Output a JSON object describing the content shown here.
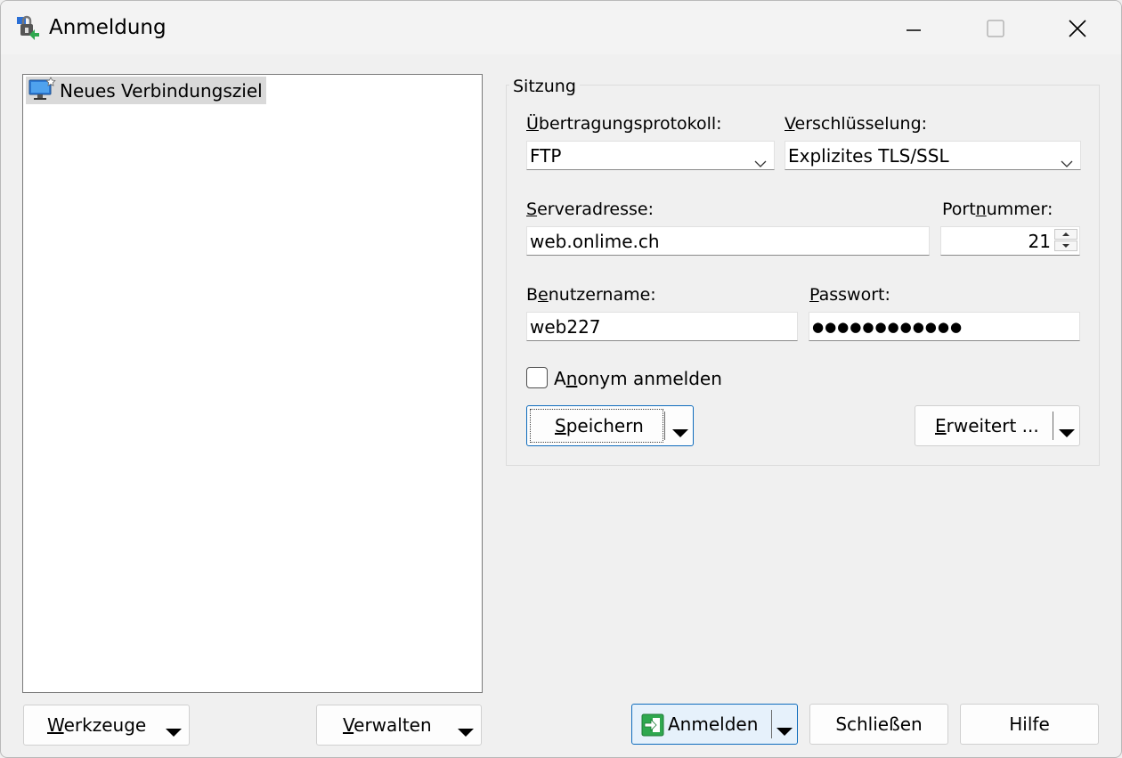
{
  "window": {
    "title": "Anmeldung",
    "controls": {
      "minimize": "minimize-icon",
      "maximize": "maximize-icon",
      "close": "close-icon"
    }
  },
  "sites_tree": {
    "items": [
      {
        "label": "Neues Verbindungsziel",
        "icon": "new-site-monitor-icon",
        "selected": true
      }
    ]
  },
  "session": {
    "group_title": "Sitzung",
    "protocol": {
      "label_access": "Ü",
      "label_rest": "bertragungsprotokoll:",
      "value": "FTP"
    },
    "encryption": {
      "label_access": "V",
      "label_rest": "erschlüsselung:",
      "value": "Explizites TLS/SSL"
    },
    "server": {
      "label_access": "S",
      "label_rest": "erveradresse:",
      "value": "web.onlime.ch"
    },
    "port": {
      "label_pre": "Port",
      "label_access": "n",
      "label_rest": "ummer:",
      "value": "21"
    },
    "username": {
      "label_pre": "B",
      "label_access": "e",
      "label_rest": "nutzername:",
      "value": "web227"
    },
    "password": {
      "label_access": "P",
      "label_rest": "asswort:",
      "value": "●●●●●●●●●●●●"
    },
    "anonymous": {
      "label_pre": "A",
      "label_access": "n",
      "label_rest": "onym anmelden",
      "checked": false
    },
    "save_button": {
      "access": "S",
      "rest": "peichern"
    },
    "advanced_button": {
      "access": "E",
      "rest": "rweitert ..."
    }
  },
  "footer": {
    "tools_button": {
      "access": "W",
      "rest": "erkzeuge"
    },
    "manage_button": {
      "access": "V",
      "rest": "erwalten"
    },
    "login_button": {
      "label": "Anmelden",
      "icon": "login-icon"
    },
    "close_button": "Schließen",
    "help_button": "Hilfe"
  },
  "colors": {
    "accent": "#0f6cbd",
    "background": "#f0f0f0",
    "selection": "#d9d9d9"
  }
}
